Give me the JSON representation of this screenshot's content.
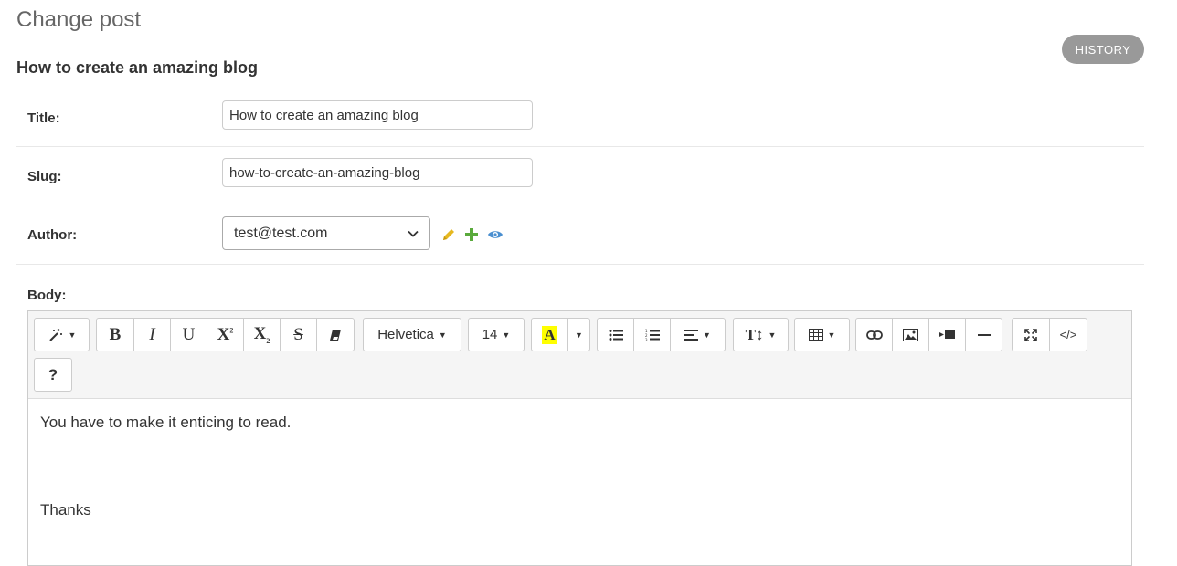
{
  "page": {
    "title": "Change post",
    "history_label": "HISTORY",
    "object_title": "How to create an amazing blog"
  },
  "form": {
    "title_label": "Title:",
    "title_value": "How to create an amazing blog",
    "slug_label": "Slug:",
    "slug_value": "how-to-create-an-amazing-blog",
    "author_label": "Author:",
    "author_value": "test@test.com",
    "body_label": "Body:"
  },
  "editor": {
    "font_name": "Helvetica",
    "font_size": "14",
    "help_label": "?",
    "content": [
      "You have to make it enticing to read.",
      "",
      "",
      "Thanks"
    ]
  },
  "icons": {
    "edit": "pencil-icon",
    "add": "plus-icon",
    "view": "eye-icon",
    "style": "magic-icon",
    "bold": "bold-icon",
    "italic": "italic-icon",
    "underline": "underline-icon",
    "superscript": "superscript-icon",
    "subscript": "subscript-icon",
    "strikethrough": "strikethrough-icon",
    "eraser": "eraser-icon",
    "color": "text-color-icon",
    "ul": "unordered-list-icon",
    "ol": "ordered-list-icon",
    "align": "align-icon",
    "height": "line-height-icon",
    "table": "table-icon",
    "link": "link-icon",
    "picture": "picture-icon",
    "video": "video-icon",
    "hr": "horizontal-rule-icon",
    "fullscreen": "fullscreen-icon",
    "codeview": "code-view-icon"
  },
  "colors": {
    "history_bg": "#999999",
    "pencil": "#e6b820",
    "plus": "#5aaa3c",
    "eye": "#4a8fd0",
    "highlight": "#ffff00"
  }
}
